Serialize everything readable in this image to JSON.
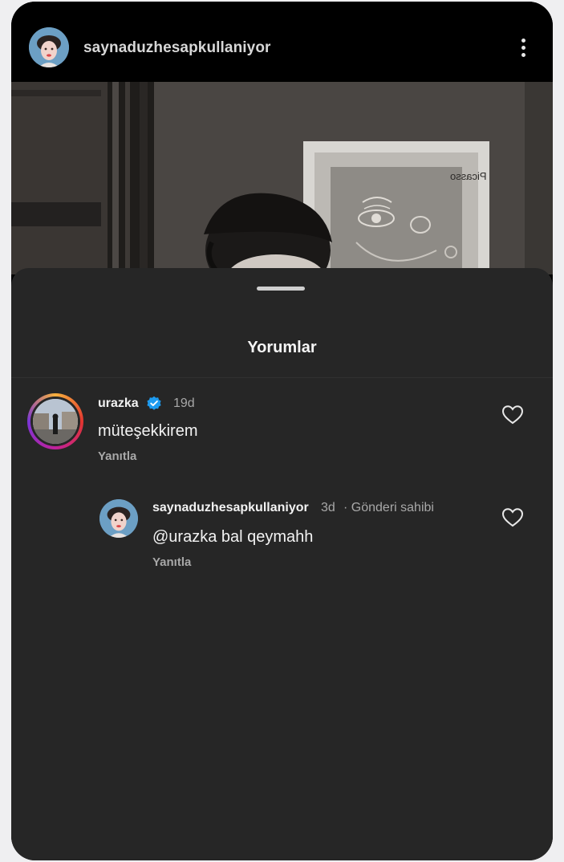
{
  "post": {
    "username": "saynaduzhesapkullaniyor",
    "more_icon": "more-vertical-icon",
    "photo_text": "Picasso"
  },
  "sheet": {
    "title": "Yorumlar"
  },
  "comments": [
    {
      "username": "urazka",
      "verified": true,
      "time": "19d",
      "text": "müteşekkirem",
      "reply_label": "Yanıtla",
      "like_icon": "heart-outline-icon"
    },
    {
      "username": "saynaduzhesapkullaniyor",
      "time": "3d",
      "author_badge": "· Gönderi sahibi",
      "text": "@urazka bal qeymahh",
      "reply_label": "Yanıtla",
      "like_icon": "heart-outline-icon"
    }
  ],
  "colors": {
    "sheet_bg": "#262626",
    "verified_blue": "#1d9bf0",
    "story_ring": [
      "#f7b03c",
      "#e2352f",
      "#c1219b",
      "#7a35d6"
    ]
  }
}
